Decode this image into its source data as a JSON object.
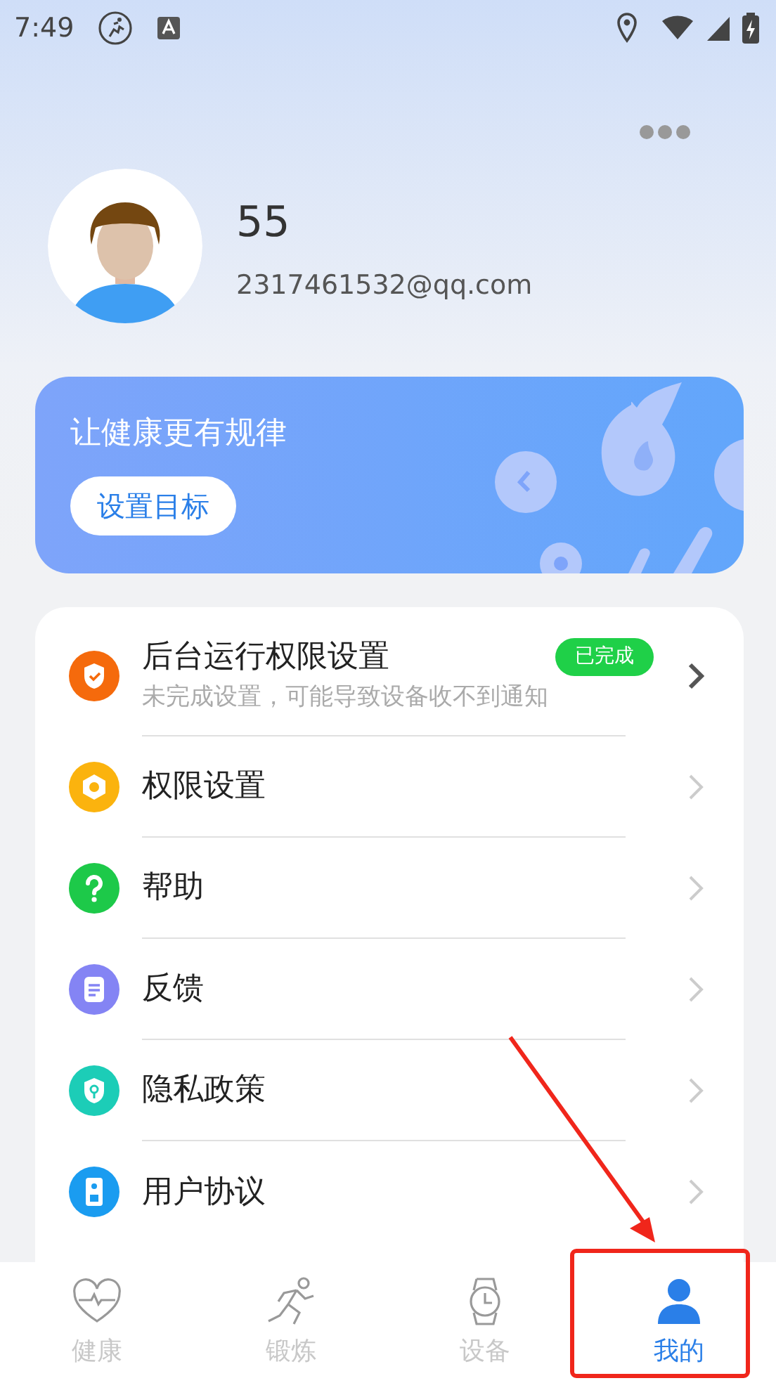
{
  "status_bar": {
    "time": "7:49"
  },
  "profile": {
    "name": "55",
    "email": "2317461532@qq.com"
  },
  "banner": {
    "title": "让健康更有规律",
    "button": "设置目标"
  },
  "menu": [
    {
      "kind": "detailed",
      "color": "#f56a0c",
      "title": "后台运行权限设置",
      "subtitle": "未完成设置，可能导致设备收不到通知",
      "badge": "已完成"
    },
    {
      "kind": "plain",
      "color": "#fbb30e",
      "title": "权限设置"
    },
    {
      "kind": "plain",
      "color": "#1dc949",
      "title": "帮助"
    },
    {
      "kind": "plain",
      "color": "#8484f4",
      "title": "反馈"
    },
    {
      "kind": "plain",
      "color": "#1ccdb7",
      "title": "隐私政策"
    },
    {
      "kind": "plain",
      "color": "#1a9cf0",
      "title": "用户协议"
    }
  ],
  "tabs": [
    {
      "label": "健康",
      "selected": false
    },
    {
      "label": "锻炼",
      "selected": false
    },
    {
      "label": "设备",
      "selected": false
    },
    {
      "label": "我的",
      "selected": true
    }
  ]
}
